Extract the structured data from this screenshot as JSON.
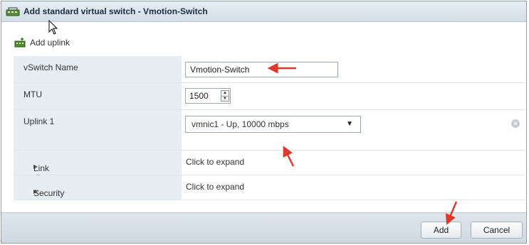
{
  "dialog": {
    "title": "Add standard virtual switch - Vmotion-Switch"
  },
  "toolbar": {
    "add_uplink_label": "Add uplink"
  },
  "form": {
    "vswitch_name": {
      "label": "vSwitch Name",
      "value": "Vmotion-Switch"
    },
    "mtu": {
      "label": "MTU",
      "value": "1500"
    },
    "uplink1": {
      "label": "Uplink 1",
      "selected": "vmnic1 - Up, 10000 mbps"
    },
    "link_discovery": {
      "label": "Link discovery",
      "value": "Click to expand"
    },
    "security": {
      "label": "Security",
      "value": "Click to expand"
    }
  },
  "footer": {
    "add_label": "Add",
    "cancel_label": "Cancel"
  },
  "colors": {
    "annotation_arrow": "#e0392b",
    "key_column_bg": "#e6edf3",
    "title_bar_bg": "#d9e2eb"
  },
  "icons": [
    "vswitch-icon",
    "add-uplink-icon",
    "spinner-up-icon",
    "spinner-down-icon",
    "dropdown-arrow-icon",
    "clear-icon",
    "mouse-cursor-icon"
  ]
}
